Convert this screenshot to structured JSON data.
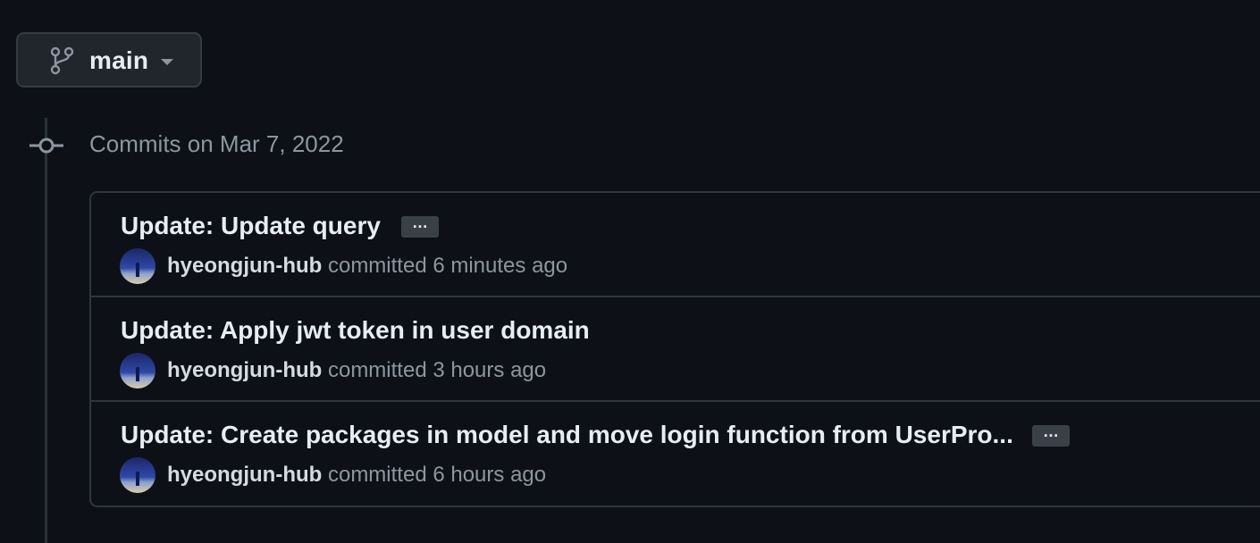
{
  "branch": {
    "name": "main",
    "icon": "git-branch-icon"
  },
  "timeline": {
    "heading": "Commits on Mar 7, 2022"
  },
  "commits": [
    {
      "title": "Update: Update query",
      "has_ellipsis": true,
      "ellipsis_label": "…",
      "author": "hyeongjun-hub",
      "action": "committed",
      "time": "6 minutes ago"
    },
    {
      "title": "Update: Apply jwt token in user domain",
      "has_ellipsis": false,
      "author": "hyeongjun-hub",
      "action": "committed",
      "time": "3 hours ago"
    },
    {
      "title": "Update: Create packages in model and move login function from UserPro...",
      "has_ellipsis": true,
      "ellipsis_label": "…",
      "author": "hyeongjun-hub",
      "action": "committed",
      "time": "6 hours ago"
    }
  ],
  "colors": {
    "background": "#0d1117",
    "border": "#30363d",
    "muted_text": "#8d96a0",
    "primary_text": "#e6edf3"
  }
}
